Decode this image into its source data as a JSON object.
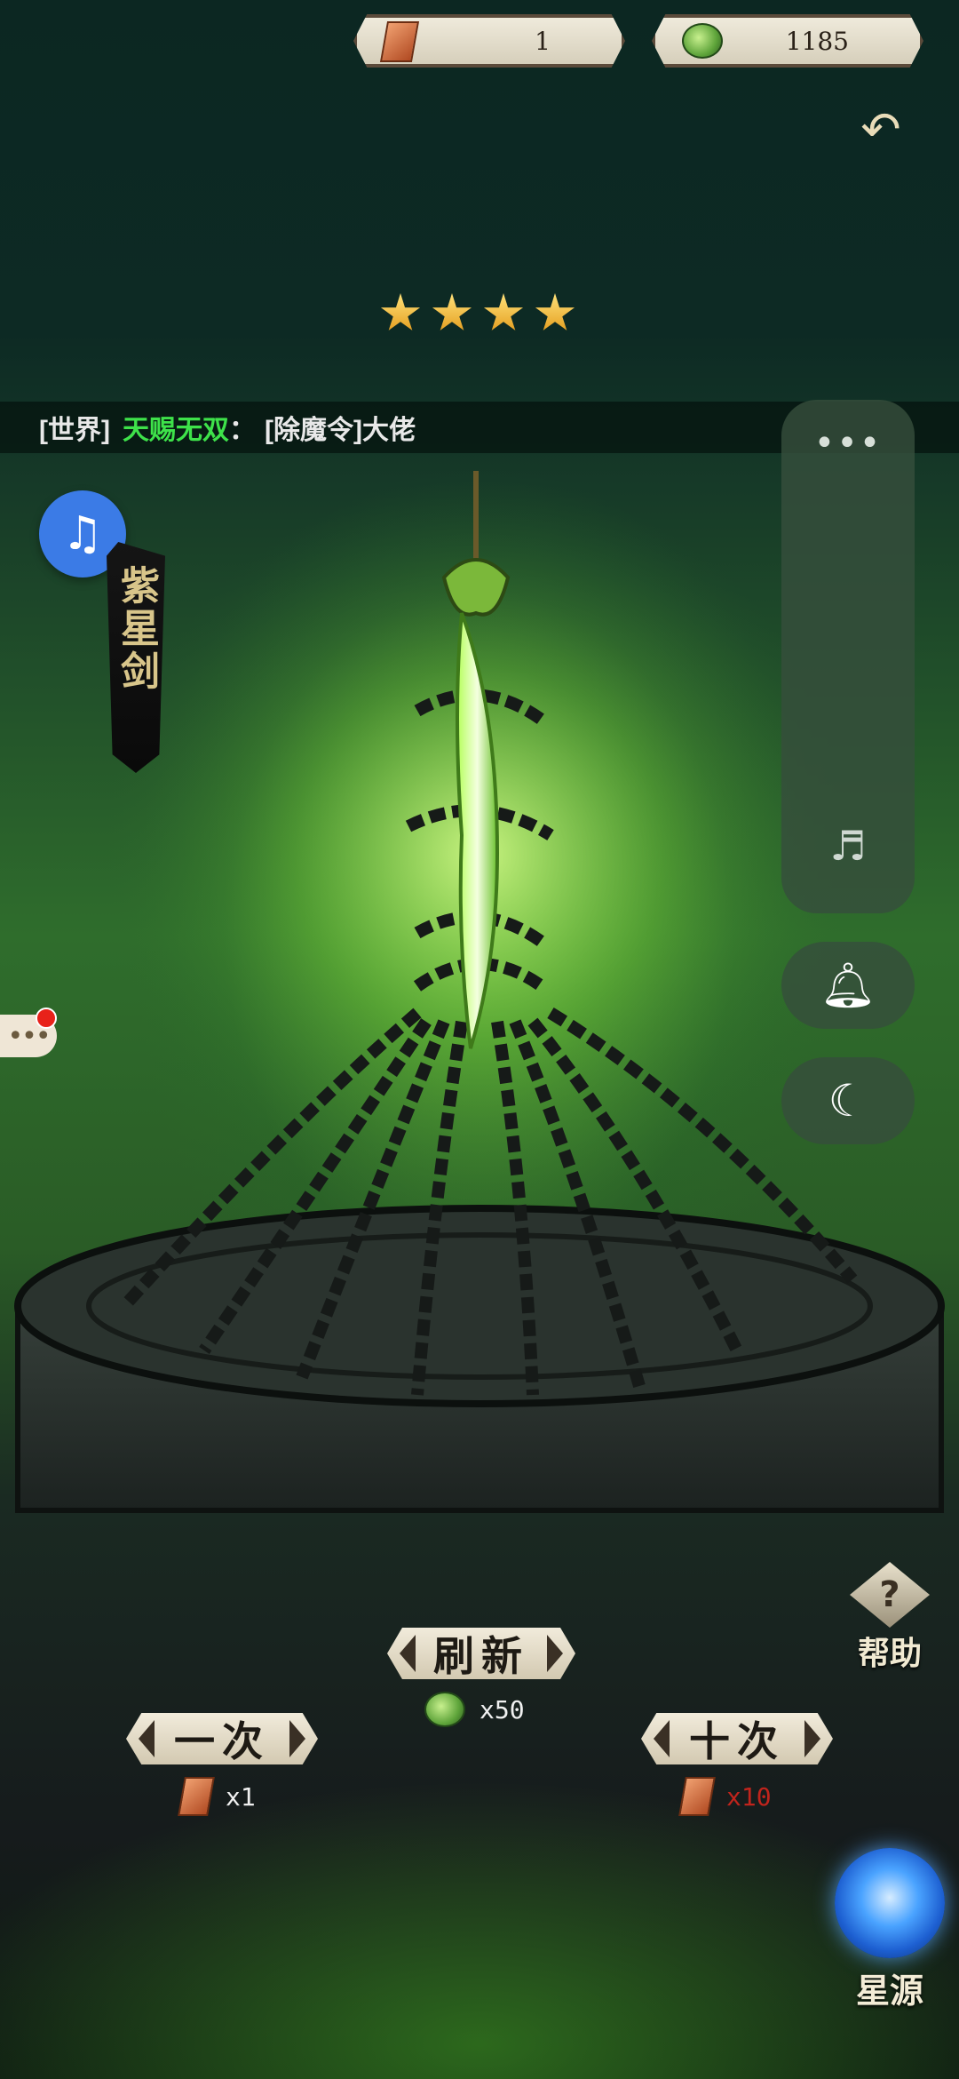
{
  "resources": {
    "token": {
      "icon": "token-icon",
      "value": "1"
    },
    "jade": {
      "icon": "jade-coin-icon",
      "value": "1185"
    }
  },
  "back": {
    "icon": "back-arrow-icon"
  },
  "rarity_stars": 4,
  "chat": {
    "channel": "[世界]",
    "sender": "天赐无双",
    "separator": "：",
    "message": "[除魔令]大佬"
  },
  "item": {
    "name": "紫星剑"
  },
  "music_button": {
    "icon": "music-note-icon"
  },
  "side_panel": {
    "more": "•••",
    "mute_icon": "music-off-icon",
    "bell_icon": "bell-icon",
    "moon_icon": "moon-icon"
  },
  "help": {
    "label": "帮助",
    "icon": "question-diamond-icon"
  },
  "refresh": {
    "label": "刷新",
    "cost": "x50",
    "currency_icon": "jade-coin-icon"
  },
  "draw_once": {
    "label": "一次",
    "cost": "x1",
    "currency_icon": "token-icon",
    "cost_color": "#f0f0f0"
  },
  "draw_ten": {
    "label": "十次",
    "cost": "x10",
    "currency_icon": "token-icon",
    "cost_color": "#c0241c"
  },
  "star_source": {
    "label": "星源",
    "icon": "blue-vortex-icon"
  },
  "colors": {
    "chat_sender": "#3ee24a",
    "accent_green": "#5ec83a"
  }
}
